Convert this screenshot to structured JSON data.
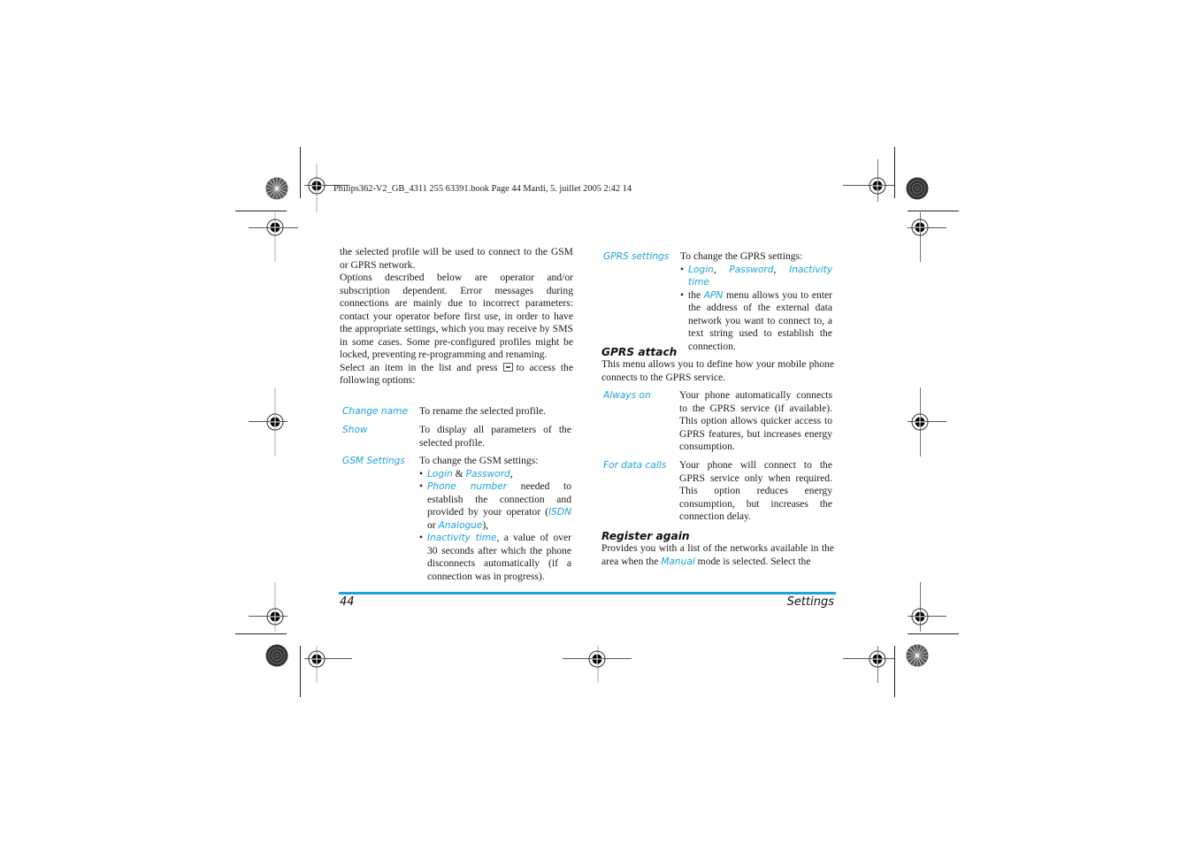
{
  "print_header": "Philips362-V2_GB_4311 255 63391.book  Page 44  Mardi, 5. juillet 2005  2:42 14",
  "colors": {
    "accent": "#1aa3e0",
    "text": "#1a1a1a"
  },
  "left_column": {
    "intro_1": "the selected profile will be used to connect to the GSM or GPRS network.",
    "intro_2": "Options described below are operator and/or subscription dependent. Error messages during connections are mainly due to incorrect parameters: contact your operator before first use, in order to have the appropriate settings, which you may receive by SMS in some cases. Some pre-configured profiles might be locked, preventing re-programming and renaming.",
    "intro_3_before": "Select an item in the list and press",
    "intro_3_icon": "ok-key-icon",
    "intro_3_after": "to access the following options:",
    "options": [
      {
        "term": "Change name",
        "desc": "To rename the selected profile."
      },
      {
        "term": "Show",
        "desc": "To display all parameters of the selected profile."
      },
      {
        "term": "GSM Settings",
        "desc": "To change the GSM settings:"
      }
    ],
    "gsm_bullets": {
      "b1": {
        "t1": "Login",
        "sep": " & ",
        "t2": "Password",
        "end": ","
      },
      "b2": {
        "t1": "Phone number",
        "text": " needed to establish the connection and provided by your operator (",
        "t2": "ISDN",
        "or": " or ",
        "t3": "Analogue",
        "end": "),"
      },
      "b3": {
        "t1": "Inactivity time",
        "text": ", a value of over 30 seconds after which the phone disconnects automatically (if a connection was in progress)."
      }
    }
  },
  "right_column": {
    "gprs_settings": {
      "term": "GPRS settings",
      "desc": "To change the GPRS settings:",
      "b1": {
        "t1": "Login",
        "s1": ", ",
        "t2": "Password",
        "s2": ", ",
        "t3": "Inactivity time"
      },
      "b2": {
        "pre": "the ",
        "t1": "APN",
        "text": " menu allows you to enter the address of the external data network you want to connect to, a text string used to establish the connection."
      }
    },
    "gprs_attach": {
      "heading": "GPRS attach",
      "body": "This menu allows you to define how your mobile phone connects to the GPRS service.",
      "options": [
        {
          "term": "Always on",
          "desc": "Your phone automatically connects to the GPRS service (if available). This option allows quicker access to GPRS features, but increases energy consumption."
        },
        {
          "term": "For data calls",
          "desc": "Your phone will connect to the GPRS service only when required. This option reduces energy consumption, but increases the connection delay."
        }
      ]
    },
    "register_again": {
      "heading": "Register again",
      "body_before": "Provides you with a list of the networks available in the area when the ",
      "term": "Manual",
      "body_after": " mode is selected. Select the"
    }
  },
  "footer": {
    "page_number": "44",
    "section": "Settings"
  }
}
